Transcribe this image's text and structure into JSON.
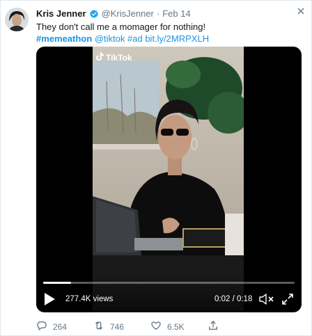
{
  "tweet": {
    "author_name": "Kris Jenner",
    "author_handle": "@KrisJenner",
    "separator": "·",
    "date": "Feb 14",
    "text_line1": "They don't call me a momager for nothing!",
    "hashtag1": "#memeathon",
    "mention": "@tiktok",
    "hashtag2": "#ad",
    "link": "bit.ly/2MRPXLH"
  },
  "video": {
    "watermark": "TikTok",
    "views": "277.4K views",
    "timecode": "0:02 / 0:18",
    "progress": 0.11
  },
  "actions": {
    "replies": "264",
    "retweets": "746",
    "likes": "6.5K"
  },
  "colors": {
    "link": "#1b95e0",
    "verified": "#1da1f2",
    "muted_text": "#657786"
  },
  "icons": [
    "verified-badge-icon",
    "tiktok-logo-icon",
    "play-icon",
    "mute-icon",
    "fullscreen-icon",
    "reply-icon",
    "retweet-icon",
    "like-icon",
    "share-icon",
    "close-icon"
  ]
}
